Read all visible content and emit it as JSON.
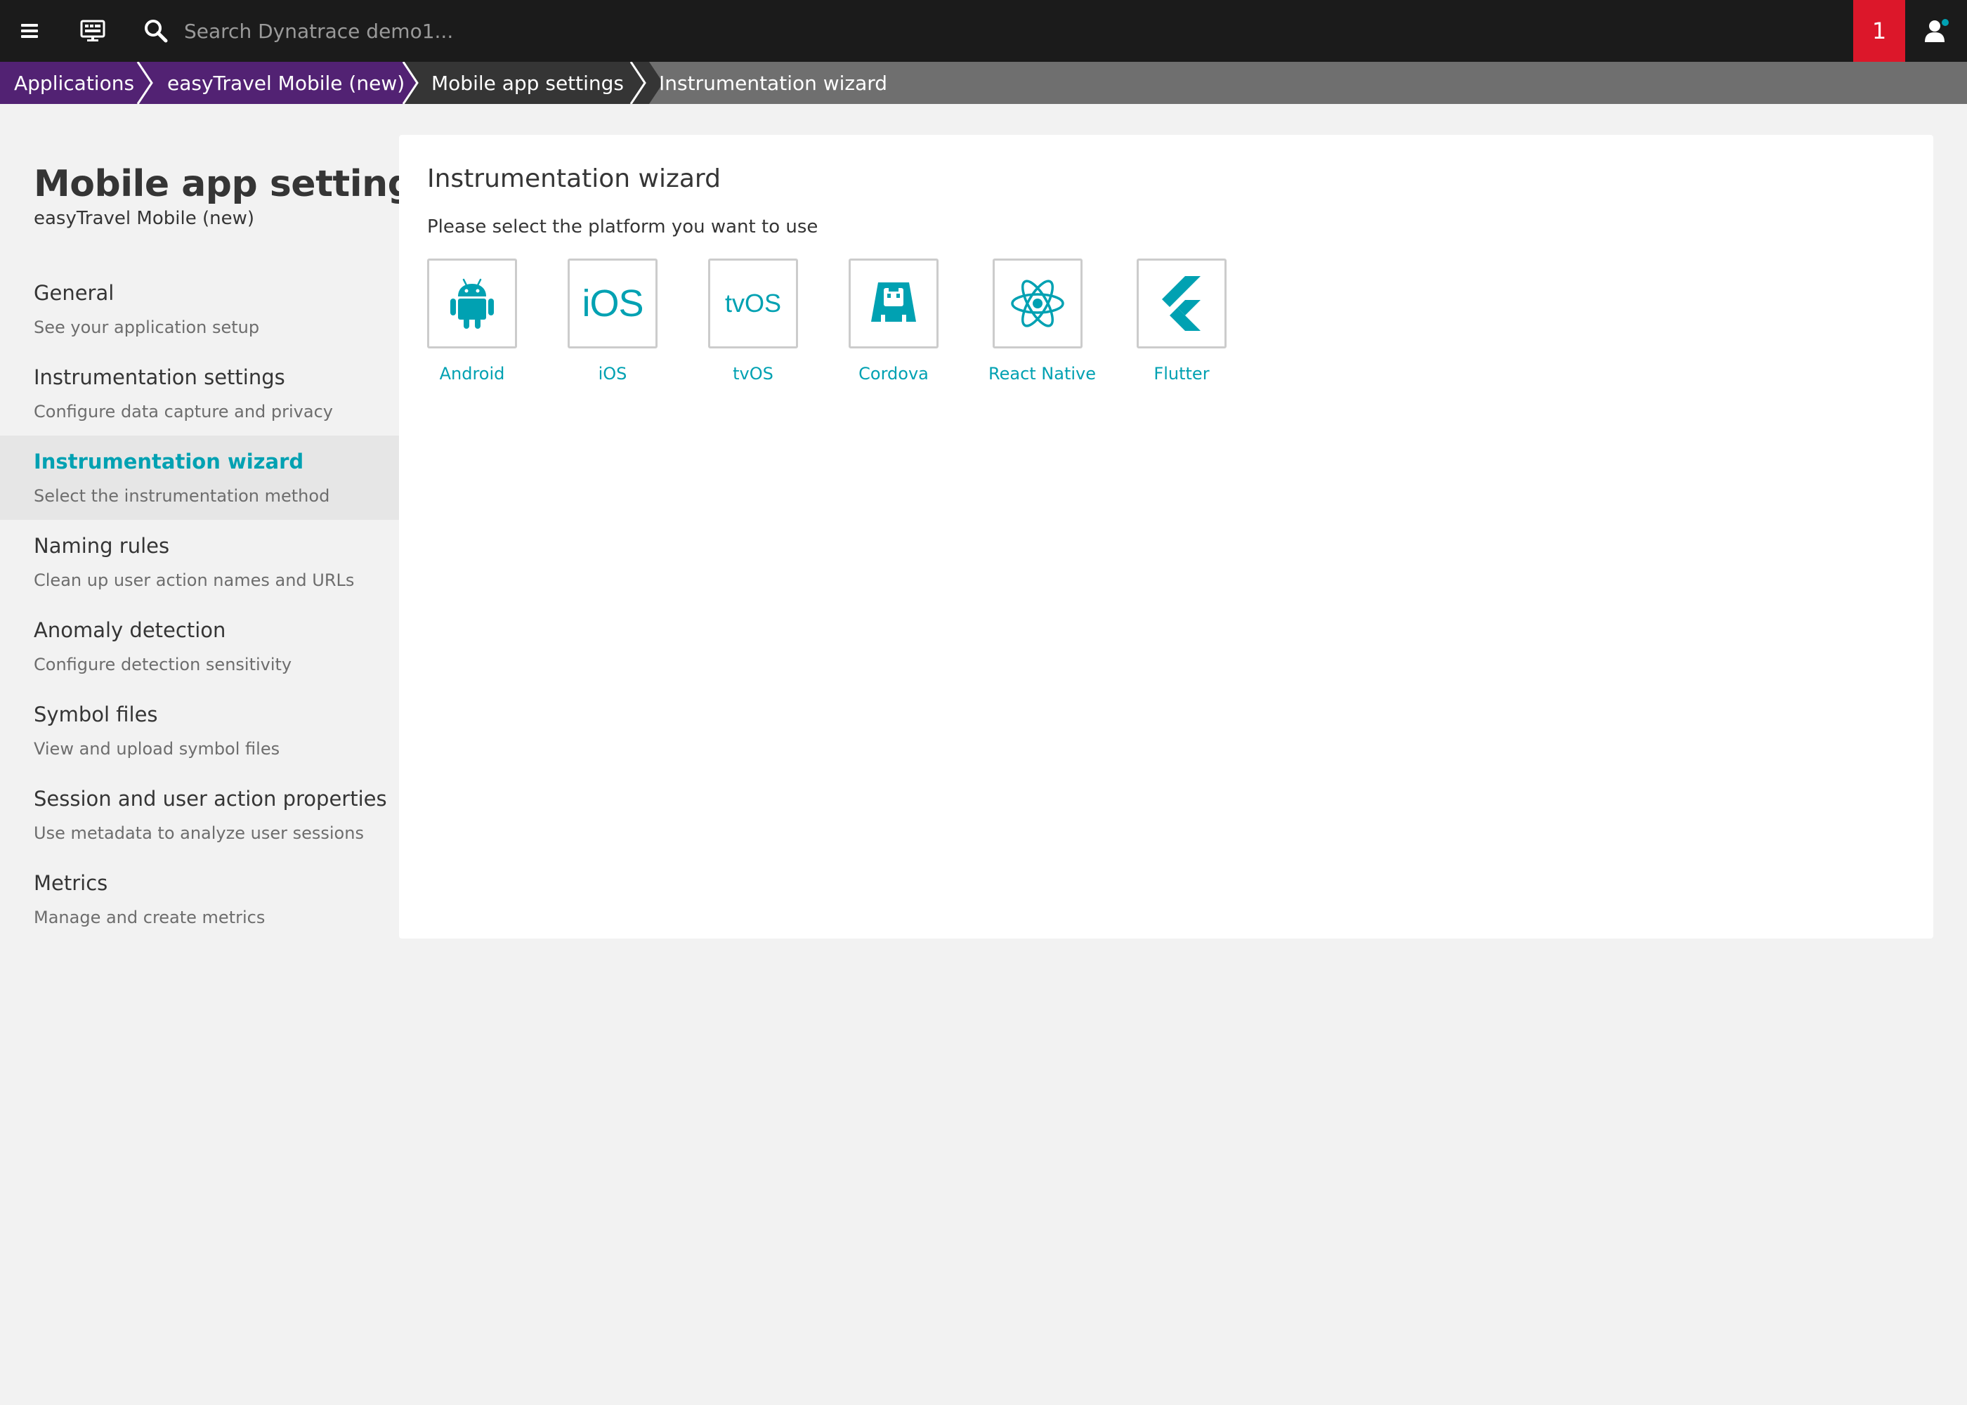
{
  "topbar": {
    "search_placeholder": "Search Dynatrace demo1...",
    "problems_count": "1",
    "icons": [
      "hamburger-menu-icon",
      "monitor-icon",
      "search-icon",
      "user-icon"
    ]
  },
  "breadcrumb": {
    "items": [
      {
        "label": "Applications"
      },
      {
        "label": "easyTravel Mobile (new)"
      },
      {
        "label": "Mobile app settings"
      },
      {
        "label": "Instrumentation wizard"
      }
    ]
  },
  "sidebar": {
    "title": "Mobile app settings",
    "subtitle": "easyTravel Mobile (new)",
    "items": [
      {
        "title": "General",
        "description": "See your application setup"
      },
      {
        "title": "Instrumentation settings",
        "description": "Configure data capture and privacy"
      },
      {
        "title": "Instrumentation wizard",
        "description": "Select the instrumentation method"
      },
      {
        "title": "Naming rules",
        "description": "Clean up user action names and URLs"
      },
      {
        "title": "Anomaly detection",
        "description": "Configure detection sensitivity"
      },
      {
        "title": "Symbol files",
        "description": "View and upload symbol files"
      },
      {
        "title": "Session and user action properties",
        "description": "Use metadata to analyze user sessions"
      },
      {
        "title": "Metrics",
        "description": "Manage and create metrics"
      }
    ]
  },
  "main": {
    "title": "Instrumentation wizard",
    "description": "Please select the platform you want to use",
    "platforms": [
      {
        "label": "Android",
        "icon": "android-icon"
      },
      {
        "label": "iOS",
        "icon": "ios-icon",
        "icon_text": "iOS"
      },
      {
        "label": "tvOS",
        "icon": "tvos-icon",
        "icon_text": "tvOS"
      },
      {
        "label": "Cordova",
        "icon": "cordova-icon"
      },
      {
        "label": "React Native",
        "icon": "react-icon"
      },
      {
        "label": "Flutter",
        "icon": "flutter-icon"
      }
    ]
  },
  "colors": {
    "topbar": "#1b1b1b",
    "breadcrumb_purple": "#522273",
    "breadcrumb_dark": "#353535",
    "breadcrumb_gray": "#6f6f6f",
    "accent": "#00a1b2",
    "problem_red": "#dc172a"
  }
}
